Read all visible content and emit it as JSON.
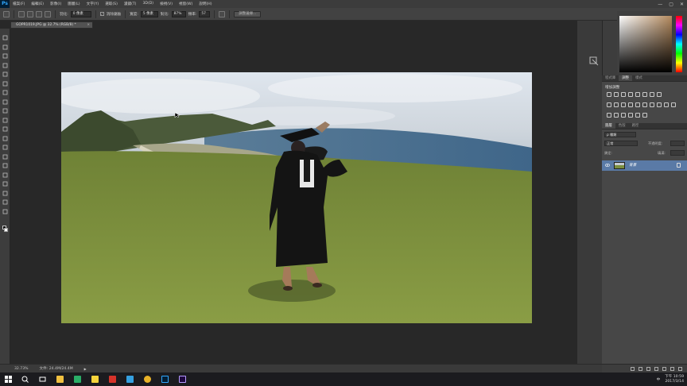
{
  "app": {
    "logo": "Ps"
  },
  "menu": [
    "檔案(F)",
    "編輯(E)",
    "影像(I)",
    "圖層(L)",
    "文字(Y)",
    "選取(S)",
    "濾鏡(T)",
    "3D(D)",
    "檢視(V)",
    "視窗(W)",
    "說明(H)"
  ],
  "window_controls": {
    "minimize": "—",
    "restore": "▢",
    "close": "✕"
  },
  "options": {
    "feather_label": "羽化:",
    "feather_value": "0 像素",
    "antialias_check": "✓",
    "antialias_label": "消除鋸齒",
    "width_label": "寬度:",
    "width_value": "5 像素",
    "contrast_label": "對比:",
    "contrast_value": "87%",
    "frequency_label": "頻率:",
    "frequency_value": "57",
    "refine_button": "調整邊緣..."
  },
  "document": {
    "tab_title": "GOPR1019.JPG @ 32.7% (RGB/8) *",
    "close": "×"
  },
  "panels": {
    "color_tabs": [],
    "adjust_tabs": [
      "程式庫",
      "調整",
      "樣式"
    ],
    "adjust_title": "增加調整",
    "layers_tabs": [
      "圖層",
      "色版",
      "路徑"
    ],
    "kind_filter": "ρ 種類",
    "blend_mode": "正常",
    "opacity_label": "不透明度:",
    "lock_label": "鎖定:",
    "fill_label": "填滿:",
    "layer_name": "背景"
  },
  "status": {
    "zoom": "32.73%",
    "doc_size": "文件: 24.4M/24.4M",
    "arrow": "▶"
  },
  "taskbar": {
    "time": "下午 10:59",
    "date": "2017/3/14",
    "ime": "中"
  },
  "colors": {
    "menu_bg": "#3c3c3c",
    "panel_bg": "#474747",
    "selected_layer": "#5a7aa6",
    "ps_blue": "#31a8ff"
  }
}
